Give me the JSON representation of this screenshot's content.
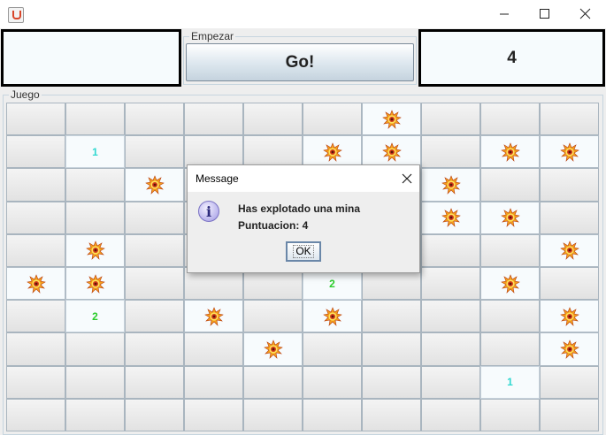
{
  "window": {
    "icons": {
      "app": "java-icon",
      "minimize": "minimize-icon",
      "maximize": "maximize-icon",
      "close": "close-icon"
    }
  },
  "header": {
    "left_display": "",
    "start_group_title": "Empezar",
    "go_label": "Go!",
    "right_display": "4"
  },
  "board": {
    "group_title": "Juego",
    "mine_icon": "mine-explosion-icon",
    "number_colors": {
      "1": "#2fd8d0",
      "2": "#2bcc2b"
    },
    "rows": [
      [
        "",
        "",
        "",
        "",
        "",
        "",
        "M",
        "",
        "",
        ""
      ],
      [
        "",
        "1",
        "",
        "",
        "",
        "M",
        "M",
        "",
        "M",
        "M"
      ],
      [
        "",
        "",
        "M",
        "",
        "",
        "",
        "",
        "M",
        "",
        ""
      ],
      [
        "",
        "",
        "",
        "",
        "",
        "",
        "",
        "M",
        "M",
        ""
      ],
      [
        "",
        "M",
        "",
        "",
        "",
        "",
        "",
        "",
        "",
        "M"
      ],
      [
        "M",
        "M",
        "",
        "",
        "",
        "2",
        "",
        "",
        "M",
        ""
      ],
      [
        "",
        "2",
        "",
        "M",
        "",
        "M",
        "",
        "",
        "",
        "M"
      ],
      [
        "",
        "",
        "",
        "",
        "M",
        "",
        "",
        "",
        "",
        "M"
      ],
      [
        "",
        "",
        "",
        "",
        "",
        "",
        "",
        "",
        "1",
        ""
      ],
      [
        "",
        "",
        "",
        "",
        "",
        "",
        "",
        "",
        "",
        ""
      ]
    ]
  },
  "dialog": {
    "title": "Message",
    "icon": "info-icon",
    "line1": "Has explotado una mina",
    "line2": "Puntuacion: 4",
    "ok_label": "OK"
  }
}
